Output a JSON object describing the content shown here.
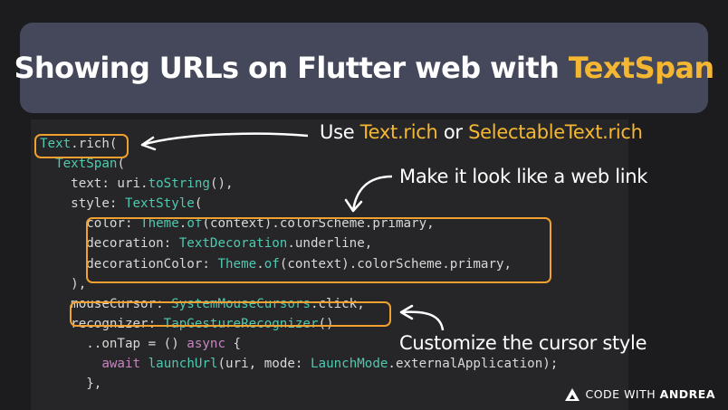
{
  "title": {
    "prefix": "Showing URLs on Flutter web with ",
    "highlight": "TextSpan"
  },
  "code_lines": [
    [
      {
        "t": "Text",
        "c": "type"
      },
      {
        "t": ".rich(",
        "c": "param"
      }
    ],
    [
      {
        "t": "  ",
        "c": "param"
      },
      {
        "t": "TextSpan",
        "c": "type"
      },
      {
        "t": "(",
        "c": "param"
      }
    ],
    [
      {
        "t": "    text: uri.",
        "c": "param"
      },
      {
        "t": "toString",
        "c": "teal"
      },
      {
        "t": "(),",
        "c": "param"
      }
    ],
    [
      {
        "t": "    style: ",
        "c": "param"
      },
      {
        "t": "TextStyle",
        "c": "type"
      },
      {
        "t": "(",
        "c": "param"
      }
    ],
    [
      {
        "t": "      color: ",
        "c": "param"
      },
      {
        "t": "Theme",
        "c": "type"
      },
      {
        "t": ".",
        "c": "param"
      },
      {
        "t": "of",
        "c": "teal"
      },
      {
        "t": "(context).colorScheme.primary,",
        "c": "param"
      }
    ],
    [
      {
        "t": "      decoration: ",
        "c": "param"
      },
      {
        "t": "TextDecoration",
        "c": "type"
      },
      {
        "t": ".underline,",
        "c": "param"
      }
    ],
    [
      {
        "t": "      decorationColor: ",
        "c": "param"
      },
      {
        "t": "Theme",
        "c": "type"
      },
      {
        "t": ".",
        "c": "param"
      },
      {
        "t": "of",
        "c": "teal"
      },
      {
        "t": "(context).colorScheme.primary,",
        "c": "param"
      }
    ],
    [
      {
        "t": "    ),",
        "c": "param"
      }
    ],
    [
      {
        "t": "    mouseCursor: ",
        "c": "param"
      },
      {
        "t": "SystemMouseCursors",
        "c": "type"
      },
      {
        "t": ".click,",
        "c": "param"
      }
    ],
    [
      {
        "t": "    recognizer: ",
        "c": "param"
      },
      {
        "t": "TapGestureRecognizer",
        "c": "type"
      },
      {
        "t": "()",
        "c": "param"
      }
    ],
    [
      {
        "t": "      ..onTap = () ",
        "c": "param"
      },
      {
        "t": "async",
        "c": "kw"
      },
      {
        "t": " {",
        "c": "param"
      }
    ],
    [
      {
        "t": "        ",
        "c": "param"
      },
      {
        "t": "await",
        "c": "kw"
      },
      {
        "t": " ",
        "c": "param"
      },
      {
        "t": "launchUrl",
        "c": "teal"
      },
      {
        "t": "(uri, mode: ",
        "c": "param"
      },
      {
        "t": "LaunchMode",
        "c": "type"
      },
      {
        "t": ".externalApplication);",
        "c": "param"
      }
    ],
    [
      {
        "t": "      },",
        "c": "param"
      }
    ]
  ],
  "notes": {
    "rich": {
      "pre": "Use ",
      "hl1": "Text.rich",
      "mid": " or ",
      "hl2": "SelectableText.rich"
    },
    "link": "Make it look like a web link",
    "cursor": "Customize the cursor style"
  },
  "brand": {
    "word1": "CODE",
    "word2": "WITH",
    "word3": "ANDREA"
  },
  "colors": {
    "accent": "#f5b731",
    "box": "#f0a030",
    "title_bg": "#45485a",
    "code_bg": "#262628",
    "page_bg": "#1c1c1e"
  }
}
